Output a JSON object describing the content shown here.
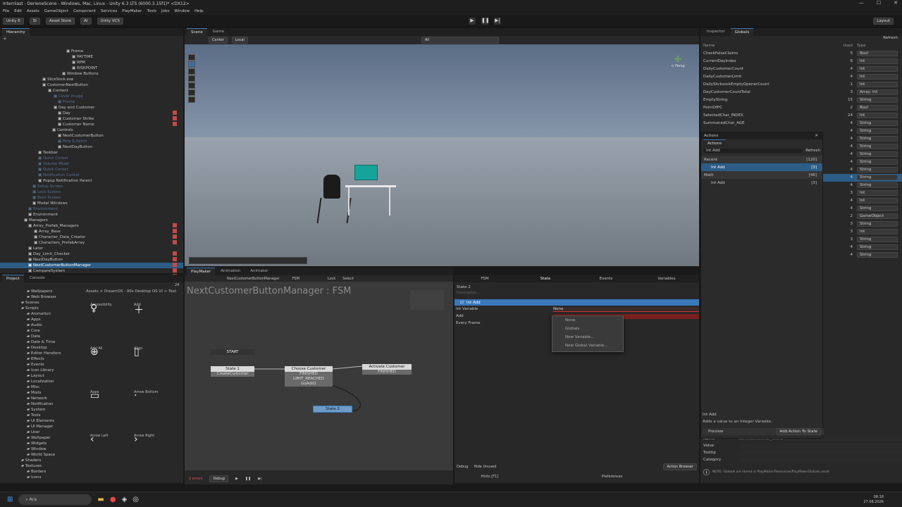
{
  "window": {
    "title": "Internlast - DerieneScene - Windows, Mac, Linux - Unity 6.3 LTS (6000.3.15f1)* <DX12>",
    "controls": [
      "—",
      "☐",
      "✕"
    ]
  },
  "menu": [
    "File",
    "Edit",
    "Assets",
    "GameObject",
    "Component",
    "Services",
    "PlayMaker",
    "Tools",
    "Jobs",
    "Window",
    "Help"
  ],
  "toolbar": {
    "unity": "Unity 6",
    "si": "SI",
    "asset_store": "Asset Store",
    "ai": "AI",
    "vcs": "Unity VCS",
    "layout": "Layout"
  },
  "hierarchy": {
    "tab": "Hierarchy",
    "search_icon": "+",
    "items": [
      {
        "l": "Frame",
        "i": 94,
        "d": false,
        "m": false
      },
      {
        "l": "PAYTIME",
        "i": 102,
        "d": false,
        "m": false
      },
      {
        "l": "RPM",
        "i": 102,
        "d": false,
        "m": false
      },
      {
        "l": "RISKPOINT",
        "i": 102,
        "d": false,
        "m": false
      },
      {
        "l": "Window Buttons",
        "i": 88,
        "d": false,
        "m": false
      },
      {
        "l": "SlickSock.exe",
        "i": 60,
        "d": false,
        "m": false
      },
      {
        "l": "CustomerNextButton",
        "i": 60,
        "d": false,
        "m": false
      },
      {
        "l": "Content",
        "i": 68,
        "d": false,
        "m": false
      },
      {
        "l": "Cover Image",
        "i": 76,
        "d": true,
        "m": false
      },
      {
        "l": "Frame",
        "i": 82,
        "d": true,
        "m": false
      },
      {
        "l": "Day and Customer",
        "i": 76,
        "d": false,
        "m": false
      },
      {
        "l": "Day",
        "i": 82,
        "d": false,
        "m": true
      },
      {
        "l": "Customer Strike",
        "i": 82,
        "d": false,
        "m": true
      },
      {
        "l": "Customer Name",
        "i": 82,
        "d": false,
        "m": true
      },
      {
        "l": "Controls",
        "i": 74,
        "d": false,
        "m": false
      },
      {
        "l": "NextCustomerButton",
        "i": 82,
        "d": false,
        "m": false
      },
      {
        "l": "Poly & Patch",
        "i": 82,
        "d": true,
        "m": false
      },
      {
        "l": "NextDayButton",
        "i": 82,
        "d": false,
        "m": false
      },
      {
        "l": "Taskbar",
        "i": 54,
        "d": false,
        "m": false
      },
      {
        "l": "Quick Center",
        "i": 54,
        "d": true,
        "m": false
      },
      {
        "l": "Volume Mixer",
        "i": 54,
        "d": true,
        "m": false
      },
      {
        "l": "Quick Center",
        "i": 54,
        "d": true,
        "m": false
      },
      {
        "l": "Notification Center",
        "i": 54,
        "d": true,
        "m": false
      },
      {
        "l": "Popup Notification Parent",
        "i": 54,
        "d": false,
        "m": false
      },
      {
        "l": "Setup Screen",
        "i": 46,
        "d": true,
        "m": false
      },
      {
        "l": "Lock Screen",
        "i": 46,
        "d": true,
        "m": false
      },
      {
        "l": "Boot Screen",
        "i": 46,
        "d": true,
        "m": false
      },
      {
        "l": "Modal Windows",
        "i": 46,
        "d": false,
        "m": false
      },
      {
        "l": "Environment",
        "i": 40,
        "d": true,
        "m": false
      },
      {
        "l": "Environment",
        "i": 40,
        "d": false,
        "m": false
      },
      {
        "l": "Managers",
        "i": 34,
        "d": false,
        "m": false
      },
      {
        "l": "Array_Prefab_Managers",
        "i": 40,
        "d": false,
        "m": true
      },
      {
        "l": "Array_Base",
        "i": 48,
        "d": false,
        "m": true
      },
      {
        "l": "Character_Data_Creator",
        "i": 48,
        "d": false,
        "m": true
      },
      {
        "l": "Characters_PrefabArray",
        "i": 48,
        "d": false,
        "m": true
      },
      {
        "l": "Later",
        "i": 40,
        "d": false,
        "m": false
      },
      {
        "l": "Day_Limit_Checker",
        "i": 40,
        "d": false,
        "m": true
      },
      {
        "l": "NextDayButton",
        "i": 40,
        "d": false,
        "m": true
      },
      {
        "l": "NextCustomerButtonManager",
        "i": 40,
        "d": false,
        "m": true,
        "s": true
      },
      {
        "l": "CompareSystem",
        "i": 40,
        "d": false,
        "m": true
      },
      {
        "l": "SlickSock.exe_Manager",
        "i": 40,
        "d": false,
        "m": true
      }
    ]
  },
  "scene": {
    "tabs": [
      "Scene",
      "Game"
    ],
    "center": "Center",
    "local": "Local",
    "persp": "< Persp",
    "search": "All"
  },
  "project": {
    "tabs": [
      "Project",
      "Console"
    ],
    "breadcrumb": "Assets > DreamOS - 90s Desktop OS UI > Text",
    "count": "24",
    "folders": [
      "Wallpapers",
      "Web Browser",
      "Scenes",
      "Scripts",
      "Animation",
      "Apps",
      "Audio",
      "Core",
      "Data",
      "Date & Time",
      "Desktop",
      "Editor Handlers",
      "Effects",
      "Events",
      "Icon Library",
      "Layout",
      "Localization",
      "Misc",
      "Mods",
      "Network",
      "Notification",
      "System",
      "Tools",
      "UI Elements",
      "UI Manager",
      "User",
      "Wallpaper",
      "Widgets",
      "Window",
      "World Space",
      "Shaders",
      "Textures",
      "Borders",
      "Icons"
    ],
    "assets": [
      "Accessibility",
      "Add",
      "Add All",
      "Align",
      "Apps",
      "Arrow Bottom",
      "Arrow Left",
      "Arrow Right"
    ]
  },
  "fsm": {
    "tabs": [
      "PlayMaker",
      "Animation",
      "Animator"
    ],
    "object": "NextCustomerButtonManager",
    "fsm": "FSM",
    "lock": "Lock",
    "select": "Select",
    "title": "NextCustomerButtonManager : FSM",
    "start": "START",
    "state1": {
      "name": "State 1",
      "t1": "CreateCustomer"
    },
    "choose": {
      "name": "Choose Customer",
      "t1": "FINISHED",
      "t2": "LIMIT_REACHED",
      "t3": "GoAdd1"
    },
    "activate": {
      "name": "Activate Customer",
      "t1": "FINISHED"
    },
    "state2": {
      "name": "State 2"
    },
    "errors": "2 errors",
    "debug": "Debug"
  },
  "inspector_fsm": {
    "tabs": [
      "FSM",
      "State",
      "Events",
      "Variables"
    ],
    "state": "State 2",
    "desc": "Description...",
    "action": "Int Add",
    "f1": "Int Variable",
    "f2": "Add",
    "f3": "Every Frame",
    "val": "None",
    "dropdown": [
      "None",
      "Globals",
      "New Variable...",
      "New Global Variable..."
    ],
    "debug": "Debug",
    "hide": "Hide Unused",
    "hints": "Hints [F1]",
    "prefs": "Preferences",
    "browser": "Action Browser"
  },
  "globals": {
    "tabs": [
      "Inspector",
      "Globals"
    ],
    "refresh": "Refresh",
    "h_name": "Name",
    "h_used": "Used",
    "h_type": "Type",
    "rows": [
      {
        "n": "CheckFalseClaims",
        "u": "5",
        "t": "Bool"
      },
      {
        "n": "CurrentDayIndex",
        "u": "8",
        "t": "Int"
      },
      {
        "n": "DailyCustomerCount",
        "u": "4",
        "t": "Int"
      },
      {
        "n": "DailyCustomerLimit",
        "u": "4",
        "t": "Int"
      },
      {
        "n": "DailySlicksockEmptyOpenerCount",
        "u": "1",
        "t": "Int"
      },
      {
        "n": "DayCustomerCountTotal",
        "u": "3",
        "t": "Array: Int"
      },
      {
        "n": "EmptyString",
        "u": "15",
        "t": "String"
      },
      {
        "n": "PointOfPC",
        "u": "2",
        "t": "Bool"
      },
      {
        "n": "SelectedChar_INDEX",
        "u": "24",
        "t": "Int"
      },
      {
        "n": "SummonedChar_AGE",
        "u": "4",
        "t": "String"
      },
      {
        "n": "",
        "u": "4",
        "t": "String"
      },
      {
        "n": "",
        "u": "4",
        "t": "String"
      },
      {
        "n": "",
        "u": "4",
        "t": "String"
      },
      {
        "n": "",
        "u": "4",
        "t": "String"
      },
      {
        "n": "",
        "u": "4",
        "t": "String"
      },
      {
        "n": "",
        "u": "4",
        "t": "String"
      },
      {
        "n": "",
        "u": "4",
        "t": "String"
      },
      {
        "n": "",
        "u": "4",
        "t": "String"
      },
      {
        "n": "",
        "u": "3",
        "t": "Int"
      },
      {
        "n": "",
        "u": "4",
        "t": "Int"
      },
      {
        "n": "",
        "u": "4",
        "t": "String"
      },
      {
        "n": "",
        "u": "2",
        "t": "GameObject"
      },
      {
        "n": "",
        "u": "3",
        "t": "String"
      },
      {
        "n": "",
        "u": "3",
        "t": "Int"
      },
      {
        "n": "",
        "u": "3",
        "t": "String"
      },
      {
        "n": "",
        "u": "4",
        "t": "String"
      },
      {
        "n": "",
        "u": "4",
        "t": "String"
      }
    ]
  },
  "actions": {
    "title": "Actions",
    "search": "Int Add",
    "refresh": "Refresh",
    "recent": "Recent",
    "recent_count": "[120]",
    "item1": "Int Add",
    "item1_count": "[3]",
    "math": "Math",
    "math_count": "[46]",
    "item2": "Int Add",
    "item2_count": "[3]",
    "foot_title": "Int Add",
    "foot_desc": "Adds a value to an Integer Variable.",
    "preview": "Preview",
    "add_btn": "Add Action To State"
  },
  "props": {
    "name": "Name",
    "name_val": "SummonedChar_NAME",
    "value": "Value",
    "tooltip": "Tooltip",
    "category": "Category",
    "note": "NOTE: Globals are stored in PlayMaker/Resources/PlayMakerGlobals.asset"
  },
  "taskbar": {
    "search": "Ara",
    "time": "08:18",
    "date": "27.08.2026"
  }
}
